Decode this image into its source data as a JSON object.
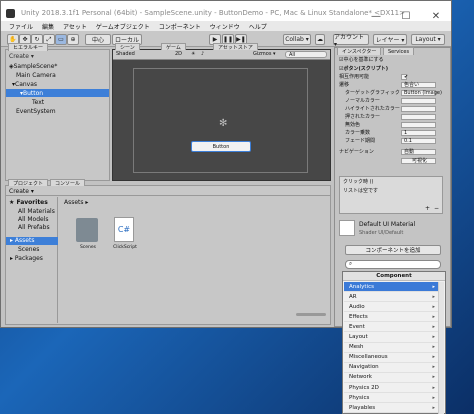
{
  "window": {
    "title": "Unity 2018.3.1f1 Personal (64bit) - SampleScene.unity - ButtonDemo - PC, Mac & Linux Standalone* <DX11>",
    "min": "—",
    "max": "☐",
    "close": "✕"
  },
  "menu": [
    "ファイル",
    "編集",
    "アセット",
    "ゲームオブジェクト",
    "コンポーネント",
    "ウィンドウ",
    "ヘルプ"
  ],
  "toolbar": {
    "pivot": "中心",
    "local": "ローカル",
    "play": "▶",
    "pause": "❚❚",
    "step": "▶❚",
    "collab": "Collab ▾",
    "account": "アカウント ▾",
    "layers": "レイヤー ▾",
    "layout": "Layout ▾"
  },
  "hierarchy": {
    "tab": "ヒエラルキー",
    "create": "Create ▾",
    "items": [
      "SampleScene*",
      "Main Camera",
      "Canvas",
      "Button",
      "Text",
      "EventSystem"
    ]
  },
  "scene": {
    "tabs": [
      "シーン",
      "ゲーム",
      "アセットストア"
    ],
    "shaded": "Shaded",
    "mode2d": "2D",
    "gizmos": "Gizmos ▾",
    "search": "All",
    "button_text": "Button"
  },
  "project": {
    "tabs": [
      "プロジェクト",
      "コンソール"
    ],
    "create": "Create ▾",
    "favorites": [
      "Favorites",
      "All Materials",
      "All Models",
      "All Prefabs"
    ],
    "tree": [
      "Assets",
      "Scenes",
      "Packages"
    ],
    "path": "Assets ▸",
    "assets": [
      {
        "name": "Scenes",
        "icon": "folder-icon"
      },
      {
        "name": "ClickScript",
        "icon": "csharp-script-icon"
      }
    ]
  },
  "inspector": {
    "tabs": [
      "インスペクター",
      "Services"
    ],
    "pivot_row": "中心を基準にする",
    "component": "ボタン(スクリプト)",
    "rows": [
      {
        "label": "相互作用可能",
        "value": "✔"
      },
      {
        "label": "遷移",
        "value": "色合い"
      },
      {
        "label": "ターゲットグラフィック",
        "value": "Button (Image)"
      },
      {
        "label": "ノーマルカラー",
        "value": ""
      },
      {
        "label": "ハイライトされたカラー",
        "value": ""
      },
      {
        "label": "押されたカラー",
        "value": ""
      },
      {
        "label": "無効色",
        "value": ""
      },
      {
        "label": "カラー乗数",
        "value": "1"
      },
      {
        "label": "フェード期間",
        "value": "0.1"
      },
      {
        "label": "ナビゲーション",
        "value": "自動"
      }
    ],
    "visualize": "可視化",
    "onclick": "クリック時 ()",
    "onclick_empty": "リストは空です",
    "material_name": "Default UI Material",
    "material_shader": "Shader  UI/Default",
    "add_component": "コンポーネントを追加"
  },
  "component_popup": {
    "title": "Component",
    "items": [
      "Analytics",
      "AR",
      "Audio",
      "Effects",
      "Event",
      "Layout",
      "Mesh",
      "Miscellaneous",
      "Navigation",
      "Network",
      "Physics 2D",
      "Physics",
      "Playables"
    ]
  },
  "colors": {
    "selected": "#3d7fd8",
    "popup_selected": "#3b7ad7",
    "scene_bg": "#474747"
  }
}
